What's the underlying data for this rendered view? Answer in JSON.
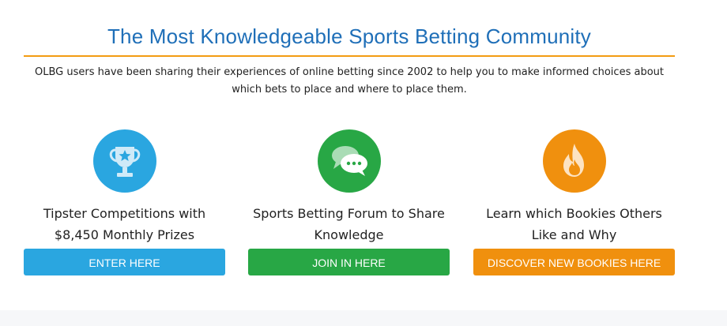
{
  "header": {
    "title": "The Most Knowledgeable Sports Betting Community",
    "intro": "OLBG users have been sharing their experiences of online betting since 2002 to help you to make informed choices about which bets to place and where to place them."
  },
  "features": [
    {
      "icon": "trophy-icon",
      "title": "Tipster Competitions with $8,450 Monthly Prizes",
      "button": "ENTER HERE",
      "color": "#2aa6e0"
    },
    {
      "icon": "chat-bubbles-icon",
      "title": "Sports Betting Forum to Share Knowledge",
      "button": "JOIN IN HERE",
      "color": "#28a745"
    },
    {
      "icon": "flame-icon",
      "title": "Learn which Bookies Others Like and Why",
      "button": "DISCOVER NEW BOOKIES HERE",
      "color": "#f0900e"
    }
  ],
  "colors": {
    "title": "#1f6fb8",
    "rule": "#f39c12",
    "strip": "#f6f7f9"
  }
}
